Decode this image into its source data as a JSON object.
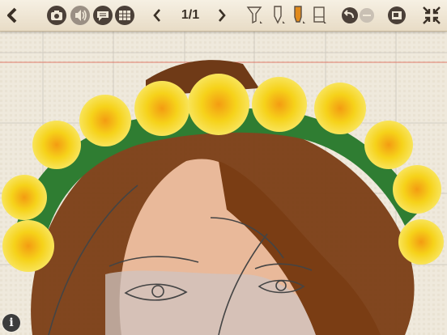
{
  "toolbar": {
    "page_indicator": "1/1",
    "icons": [
      "back-icon",
      "camera-icon",
      "speaker-icon",
      "speech-bubble-icon",
      "grid-icon",
      "previous-page-icon",
      "next-page-icon",
      "filter-pen-icon",
      "pen-icon",
      "marker-icon",
      "eraser-icon",
      "undo-icon",
      "redo-icon",
      "crop-icon",
      "collapse-icon"
    ],
    "accent": "#3a3026"
  },
  "info": {
    "label": "i"
  },
  "canvas": {
    "grid": true,
    "colors": {
      "hair": "#7a3d14",
      "skin": "#e9b99a",
      "leaves": "#2f7d32",
      "flowers": "#f4cf14",
      "line": "#444444"
    }
  }
}
